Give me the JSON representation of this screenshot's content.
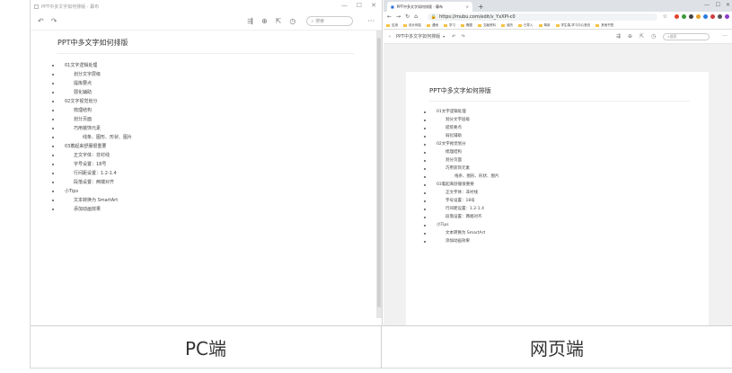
{
  "pc": {
    "window_title": "PPT中多文字如何排版 - 幕布",
    "search_placeholder": "搜索",
    "more": "···"
  },
  "web": {
    "tab_title": "PPT中多文字如何排版 - 幕布",
    "url": "https://mubu.com/edit/v_YxXPl-c0",
    "bookmarks": [
      "应用",
      "设计网站",
      "遇雨",
      "学习",
      "概图",
      "文献资料",
      "读历",
      "已导入",
      "萬用",
      "学生端-学习中心首页",
      "其他书签"
    ],
    "app_title": "PPT中多文字如何排版",
    "search_placeholder": "搜索"
  },
  "document": {
    "title": "PPT中多文字如何排版",
    "outline": [
      {
        "level": 1,
        "text": "01文字逻辑处理"
      },
      {
        "level": 2,
        "text": "划分文字层级"
      },
      {
        "level": 2,
        "text": "提炼要点"
      },
      {
        "level": 2,
        "text": "弱化辅助"
      },
      {
        "level": 1,
        "text": "02文字视觉划分"
      },
      {
        "level": 2,
        "text": "梳理结构"
      },
      {
        "level": 2,
        "text": "划分页面"
      },
      {
        "level": 2,
        "text": "巧用装饰元素"
      },
      {
        "level": 3,
        "text": "线条、图形、形状、图片"
      },
      {
        "level": 1,
        "text": "03着起来舒服很重要"
      },
      {
        "level": 2,
        "text": "正文字体：非衬线"
      },
      {
        "level": 2,
        "text": "字号设置：18号"
      },
      {
        "level": 2,
        "text": "行间距设置：1.2-1.4"
      },
      {
        "level": 2,
        "text": "段落设置：两端对齐"
      },
      {
        "level": 1,
        "text": "小Tips"
      },
      {
        "level": 2,
        "text": "文本转换为 SmartArt"
      },
      {
        "level": 2,
        "text": "添加动画效果"
      }
    ]
  },
  "captions": {
    "left": "PC端",
    "right": "网页端"
  },
  "colors": {
    "ext_icons": [
      "#e0442a",
      "#3a9a3a",
      "#444444",
      "#e8a02c",
      "#2a7be4",
      "#d23c3c",
      "#555555",
      "#8a3cc9"
    ]
  }
}
